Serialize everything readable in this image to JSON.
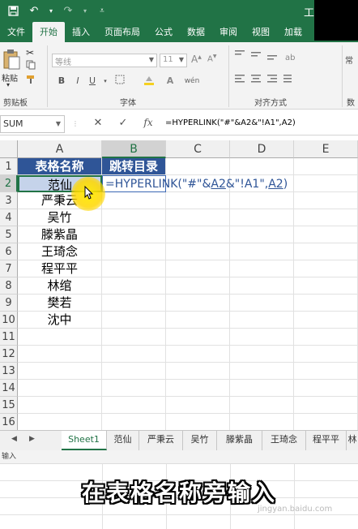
{
  "app": {
    "title_fragment": "工",
    "accent": "#217346"
  },
  "tabs": [
    {
      "label": "文件"
    },
    {
      "label": "开始"
    },
    {
      "label": "插入"
    },
    {
      "label": "页面布局"
    },
    {
      "label": "公式"
    },
    {
      "label": "数据"
    },
    {
      "label": "审阅"
    },
    {
      "label": "视图"
    },
    {
      "label": "加载"
    }
  ],
  "ribbon": {
    "paste_label": "粘贴",
    "clipboard_group": "剪贴板",
    "font_group": "字体",
    "align_group": "对齐方式",
    "number_group": "数",
    "font_name": "等线",
    "font_size": "11",
    "bold": "B",
    "italic": "I",
    "underline": "U",
    "wen": "wén",
    "general_fragment": "常"
  },
  "formula_bar": {
    "name_box": "SUM",
    "cancel": "✕",
    "enter": "✓",
    "fx": "fx",
    "formula": "=HYPERLINK(\"#\"&A2&\"!A1\",A2)"
  },
  "grid": {
    "columns": [
      "A",
      "B",
      "C",
      "D",
      "E"
    ],
    "rows": [
      "1",
      "2",
      "3",
      "4",
      "5",
      "6",
      "7",
      "8",
      "9",
      "10",
      "11",
      "12",
      "13",
      "14",
      "15",
      "16"
    ],
    "header_a": "表格名称",
    "header_b": "跳转目录",
    "names": [
      "范仙",
      "严秉云",
      "吴竹",
      "滕紫晶",
      "王琦念",
      "程平平",
      "林绾",
      "樊若",
      "沈中"
    ],
    "b2_parts": {
      "p1": "=HYPERLINK(\"#\"&",
      "r1": "A2",
      "p2": "&\"!A1\",",
      "r2": "A2",
      "p3": ")"
    }
  },
  "sheet_tabs": [
    "Sheet1",
    "范仙",
    "严秉云",
    "吴竹",
    "滕紫晶",
    "王琦念",
    "程平平",
    "林"
  ],
  "status": {
    "mode": "输入"
  },
  "caption": "在表格名称旁输入",
  "watermark": "jingyan.baidu.com"
}
